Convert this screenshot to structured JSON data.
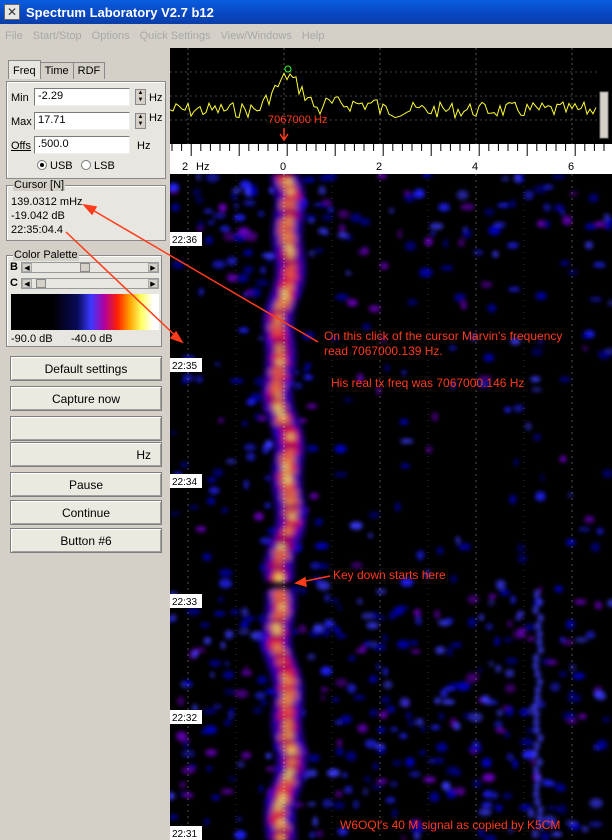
{
  "window": {
    "title": "Spectrum Laboratory V2.7 b12",
    "icon": "app-icon"
  },
  "menu": [
    "File",
    "Start/Stop",
    "Options",
    "Quick Settings",
    "View/Windows",
    "Help"
  ],
  "tabs": [
    "Freq",
    "Time",
    "RDF"
  ],
  "freq": {
    "min_label": "Min",
    "min_value": "-2.29",
    "min_unit": "Hz",
    "max_label": "Max",
    "max_value": "17.71",
    "max_unit": "Hz",
    "offs_label": "Offs",
    "offs_value": ".500.0",
    "offs_unit": "Hz",
    "usb": "USB",
    "lsb": "LSB"
  },
  "cursor": {
    "title": "Cursor [N]",
    "freq": "139.0312 mHz",
    "level": "-19.042 dB",
    "time": "22:35:04.4"
  },
  "palette": {
    "title": "Color Palette",
    "b": "B",
    "c": "C",
    "min_db": "-90.0 dB",
    "max_db": "-40.0 dB"
  },
  "buttons": {
    "default": "Default settings",
    "capture": "Capture now",
    "hz": "Hz",
    "pause": "Pause",
    "continue": "Continue",
    "button6": "Button #6"
  },
  "spectrum": {
    "marker": "7067000 Hz"
  },
  "scale": {
    "ticks": [
      "2",
      "Hz",
      "0",
      "2",
      "4",
      "6"
    ]
  },
  "waterfall": {
    "times": [
      "22:36",
      "22:35",
      "22:34",
      "22:33",
      "22:32",
      "22:31"
    ]
  },
  "annotations": {
    "line1": "On this click of the cursor Marvin's frequency",
    "line2": "read 7067000.139 Hz.",
    "line3": "His real tx freq was 7067000.146 Hz",
    "keydown": "Key down starts here",
    "credit": "W6OQI's 40 M signal as copied by K5CM"
  },
  "colors": {
    "annotation": "#ff3b1a",
    "trace": "#ffff30",
    "title_bar": "#0846c0"
  }
}
